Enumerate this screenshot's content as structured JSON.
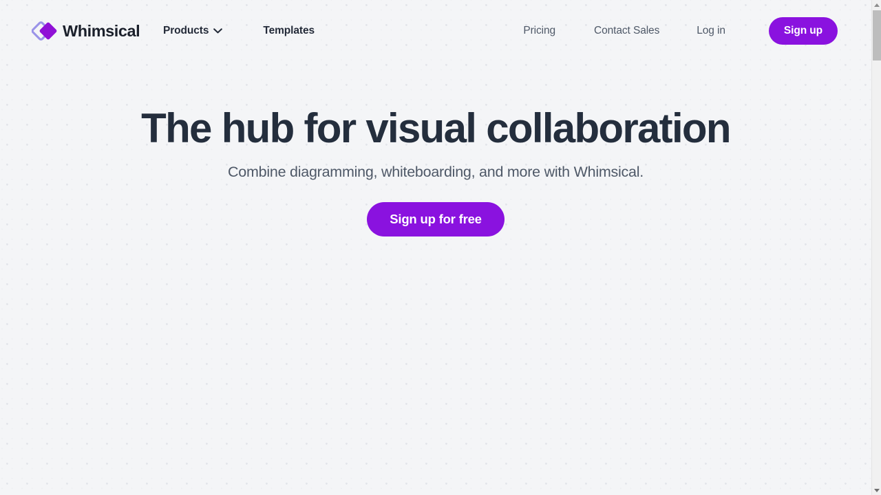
{
  "brand": {
    "name": "Whimsical",
    "logo_icon": "whimsical-diamond-logo",
    "outline_color": "#9a93e8",
    "fill_color": "#9011d6"
  },
  "header": {
    "nav_left": [
      {
        "label": "Products",
        "icon": "chevron-down-icon",
        "has_dropdown": true
      },
      {
        "label": "Templates",
        "has_dropdown": false
      }
    ],
    "nav_right": [
      {
        "label": "Pricing"
      },
      {
        "label": "Contact Sales"
      },
      {
        "label": "Log in"
      }
    ],
    "signup_button": "Sign up"
  },
  "hero": {
    "title": "The hub for visual collaboration",
    "subtitle": "Combine diagramming, whiteboarding, and more with Whimsical.",
    "cta_label": "Sign up for free"
  },
  "scrollbar": {
    "up_icon": "scroll-up-arrow-icon",
    "down_icon": "scroll-down-arrow-icon"
  },
  "colors": {
    "accent_purple": "#8A12DF",
    "page_background": "#f4f5f7",
    "heading_text": "#242e3d",
    "body_text": "#4e5867",
    "dot_grid": "#e3e5ea"
  }
}
